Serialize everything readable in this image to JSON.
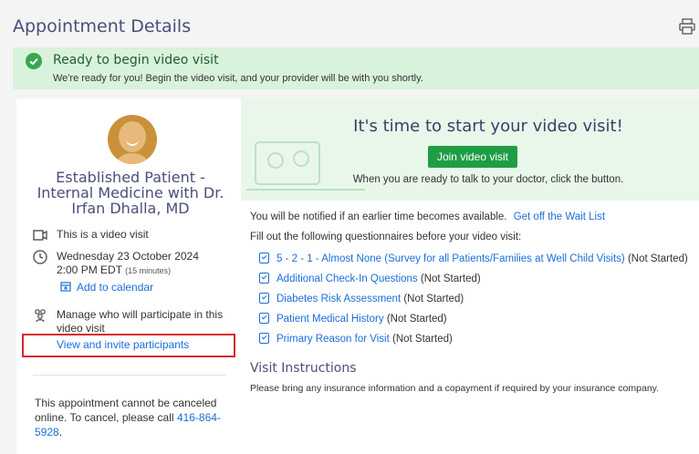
{
  "header": {
    "title": "Appointment Details",
    "print_icon": "print-icon"
  },
  "banner": {
    "title": "Ready to begin video visit",
    "subtitle": "We're ready for you! Begin the video visit, and your provider will be with you shortly.",
    "icon": "check-circle-icon",
    "color": "#3aa651"
  },
  "provider": {
    "name": "Established Patient - Internal Medicine with Dr. Irfan Dhalla, MD"
  },
  "details": {
    "video_label": "This is a video visit",
    "date": "Wednesday 23 October 2024",
    "time": "2:00 PM EDT",
    "duration": "(15 minutes)",
    "add_calendar": "Add to calendar",
    "participants_text": "Manage who will participate in this video visit",
    "invite_link": "View and invite participants",
    "cancel_text": "This appointment cannot be canceled online. To cancel, please call",
    "phone": "416-864-5928",
    "phone_suffix": "."
  },
  "video": {
    "title": "It's time to start your video visit!",
    "join_button": "Join video visit",
    "hint": "When you are ready to talk to your doctor, click the button.",
    "button_color": "#1f9d45"
  },
  "waitlist": {
    "text": "You will be notified if an earlier time becomes available.",
    "link": "Get off the Wait List"
  },
  "questionnaires": {
    "intro": "Fill out the following questionnaires before your video visit:",
    "items": [
      {
        "label": "5 - 2 - 1 - Almost None (Survey for all Patients/Families at Well Child Visits)",
        "status": "(Not Started)"
      },
      {
        "label": "Additional Check-In Questions",
        "status": "(Not Started)"
      },
      {
        "label": "Diabetes Risk Assessment",
        "status": "(Not Started)"
      },
      {
        "label": "Patient Medical History",
        "status": "(Not Started)"
      },
      {
        "label": "Primary Reason for Visit",
        "status": "(Not Started)"
      }
    ]
  },
  "instructions": {
    "title": "Visit Instructions",
    "text": "Please bring any insurance information and a copayment if required by your insurance company."
  }
}
